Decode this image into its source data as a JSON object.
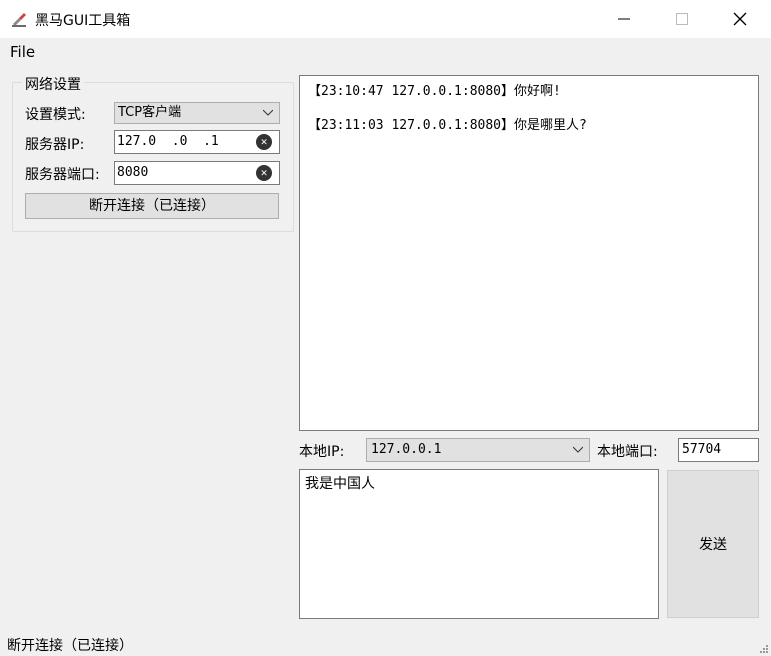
{
  "window": {
    "title": "黑马GUI工具箱",
    "controls": {
      "minimize": "minimize-icon",
      "maximize": "maximize-icon",
      "close": "close-icon"
    }
  },
  "menu": {
    "file": "File"
  },
  "network": {
    "group_title": "网络设置",
    "mode_label": "设置模式:",
    "mode_value": "TCP客户端",
    "ip_label": "服务器IP:",
    "ip_value": "127.0  .0  .1",
    "port_label": "服务器端口:",
    "port_value": "8080",
    "connect_button": "断开连接（已连接）"
  },
  "receive": {
    "messages": [
      "【23:10:47 127.0.0.1:8080】你好啊!",
      "【23:11:03 127.0.0.1:8080】你是哪里人?"
    ]
  },
  "local": {
    "ip_label": "本地IP:",
    "ip_value": "127.0.0.1",
    "port_label": "本地端口:",
    "port_value": "57704"
  },
  "send": {
    "text": "我是中国人",
    "button": "发送"
  },
  "status_bar": {
    "text": "断开连接（已连接）"
  },
  "colors": {
    "window_bg": "#f0f0f0",
    "button_bg": "#e1e1e1",
    "field_border": "#7a7a7a"
  }
}
